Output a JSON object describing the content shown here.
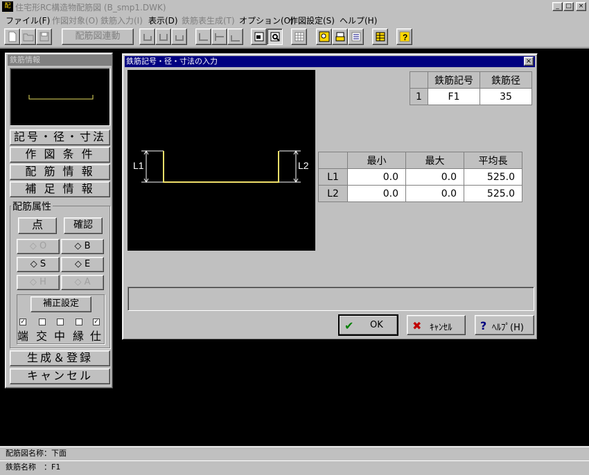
{
  "window": {
    "title": "住宅形RC構造物配筋図 (B_smp1.DWK)",
    "app_icon_label": "配筋",
    "minimize": "_",
    "maximize": "□",
    "close": "×"
  },
  "menu": [
    {
      "label": "ファイル(F)",
      "enabled": true
    },
    {
      "label": "作図対象(O)",
      "enabled": false
    },
    {
      "label": "鉄筋入力(I)",
      "enabled": false
    },
    {
      "label": "表示(D)",
      "enabled": true
    },
    {
      "label": "鉄筋表生成(T)",
      "enabled": false
    },
    {
      "label": "オプション(O)",
      "enabled": true
    },
    {
      "label": "作図設定(S)",
      "enabled": true
    },
    {
      "label": "ヘルプ(H)",
      "enabled": true
    }
  ],
  "toolbar": {
    "wide_button_label": "配筋図連動"
  },
  "left_panel": {
    "title": "鉄筋情報",
    "buttons": [
      "記号・径・寸法",
      "作 図 条 件",
      "配 筋 情 報",
      "補 足 情 報"
    ],
    "group_label": "配筋属性",
    "point_button": "点",
    "confirm_button": "確認",
    "diamonds": [
      {
        "label": "◇ O",
        "enabled": false
      },
      {
        "label": "◇ B",
        "enabled": true
      },
      {
        "label": "◇ S",
        "enabled": true
      },
      {
        "label": "◇ E",
        "enabled": true
      },
      {
        "label": "◇ H",
        "enabled": false
      },
      {
        "label": "◇ A",
        "enabled": false
      }
    ],
    "correction_button": "補正設定",
    "checks": [
      {
        "label": "端",
        "checked": true
      },
      {
        "label": "交",
        "checked": false
      },
      {
        "label": "中",
        "checked": false
      },
      {
        "label": "縁",
        "checked": false
      },
      {
        "label": "仕",
        "checked": true
      }
    ],
    "check_mark": "✓",
    "generate_button": "生成＆登録",
    "cancel_button": "キャンセル"
  },
  "dialog": {
    "title": "鉄筋記号・径・寸法の入力",
    "close": "×",
    "diagram": {
      "label_l1": "L1",
      "label_l2": "L2"
    },
    "symbol_table": {
      "headers": [
        "鉄筋記号",
        "鉄筋径"
      ],
      "rows": [
        {
          "index": "1",
          "symbol": "F1",
          "diameter": "35"
        }
      ]
    },
    "length_table": {
      "headers": [
        "最小",
        "最大",
        "平均長"
      ],
      "rows": [
        {
          "name": "L1",
          "min": "0.0",
          "max": "0.0",
          "avg": "525.0"
        },
        {
          "name": "L2",
          "min": "0.0",
          "max": "0.0",
          "avg": "525.0"
        }
      ]
    },
    "ok_label": "OK",
    "cancel_label": "ｷｬﾝｾﾙ",
    "help_label": "ﾍﾙﾌﾟ(H)",
    "ok_icon": "✔",
    "cancel_icon": "✖",
    "help_icon": "?"
  },
  "status": {
    "line1": "配筋図名称：下面",
    "line2": "鉄筋名称　：F1"
  }
}
